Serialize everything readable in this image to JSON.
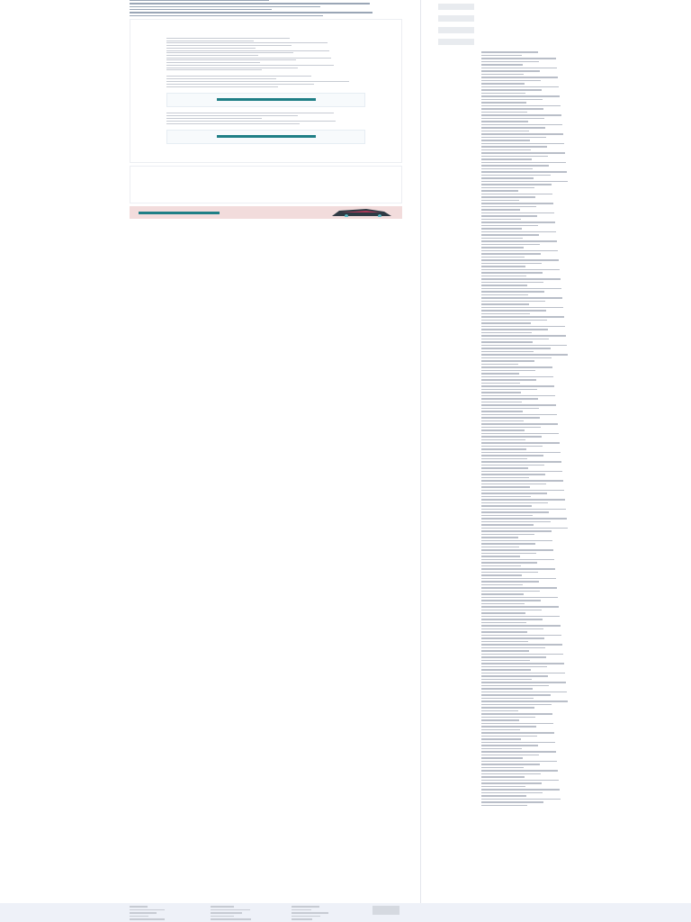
{
  "main": [
    {
      "kind": "header"
    },
    {
      "kind": "article"
    },
    {
      "kind": "blank"
    },
    {
      "kind": "banner"
    }
  ],
  "aside": [
    {
      "kind": "thumbs"
    },
    {
      "kind": "links"
    }
  ],
  "footer": [
    {
      "kind": "links"
    },
    {
      "kind": "links"
    },
    {
      "kind": "links"
    },
    {
      "kind": "icons"
    }
  ]
}
